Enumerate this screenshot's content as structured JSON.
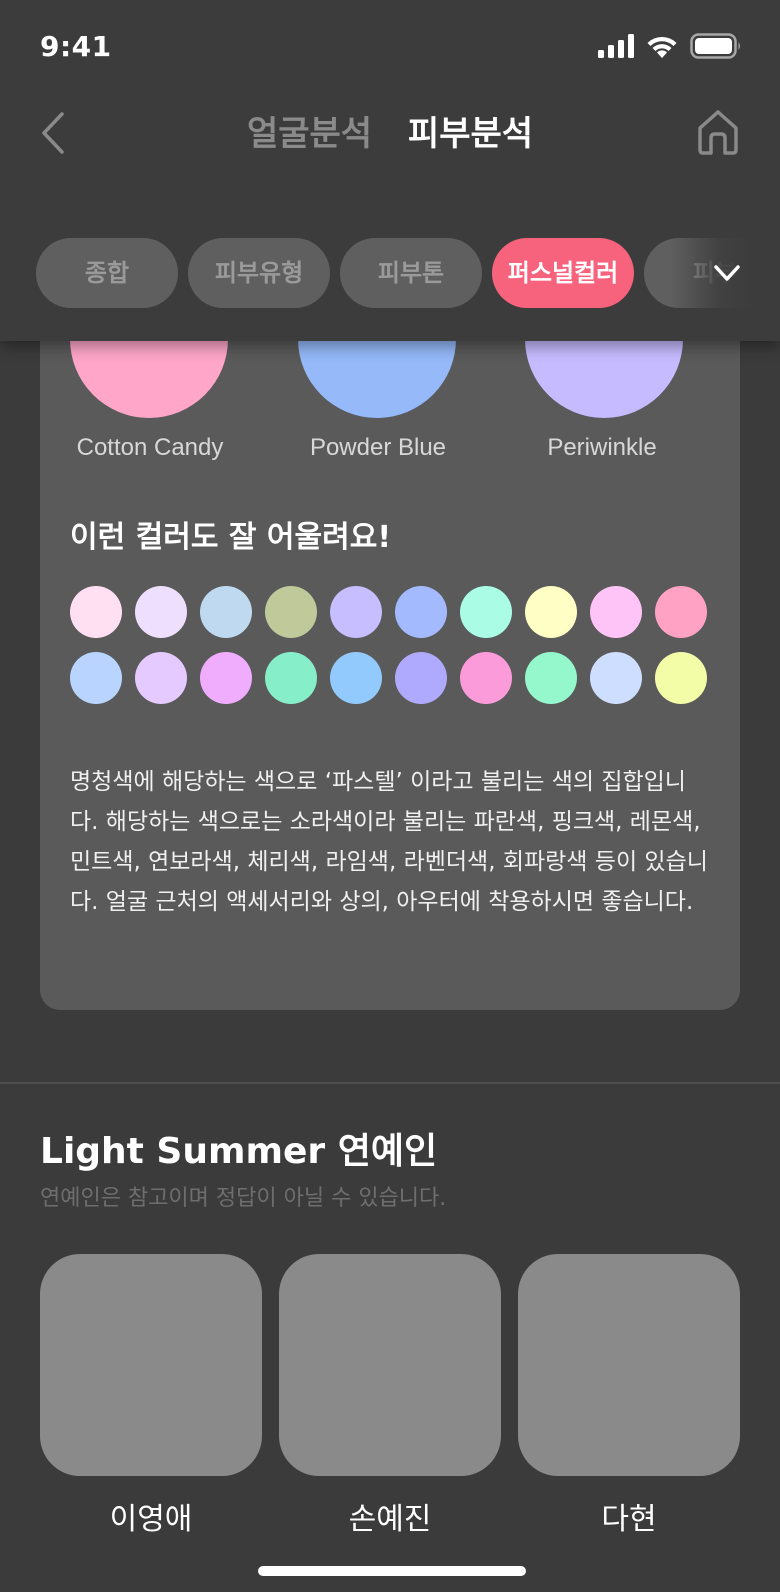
{
  "status_bar": {
    "time": "9:41"
  },
  "nav": {
    "tabs": [
      {
        "label": "얼굴분석",
        "active": false
      },
      {
        "label": "피부분석",
        "active": true
      }
    ]
  },
  "chips": [
    {
      "label": "종합",
      "active": false
    },
    {
      "label": "피부유형",
      "active": false
    },
    {
      "label": "피부톤",
      "active": false
    },
    {
      "label": "퍼스널컬러",
      "active": true
    },
    {
      "label": "피부",
      "active": false
    }
  ],
  "card": {
    "swatches": [
      {
        "name": "Cotton Candy",
        "color": "#ffa6c9"
      },
      {
        "name": "Powder Blue",
        "color": "#95b9f9"
      },
      {
        "name": "Periwinkle",
        "color": "#c6bbff"
      }
    ],
    "subtitle": "이런 컬러도 잘 어울려요!",
    "dot_rows": [
      [
        "#fee0f2",
        "#eedfff",
        "#bfd9f0",
        "#bfc99a",
        "#c6beff",
        "#a3baff",
        "#abfce5",
        "#fefec5",
        "#ffc4f7",
        "#ffa2c3"
      ],
      [
        "#b9d5ff",
        "#e4caff",
        "#f0adfe",
        "#86eec9",
        "#93cafe",
        "#b0aafe",
        "#fc9bd9",
        "#94f8cc",
        "#cedeff",
        "#f3fda7"
      ]
    ],
    "description": "명청색에 해당하는 색으로 ‘파스텔’ 이라고 불리는 색의 집합입니다. 해당하는 색으로는 소라색이라 불리는 파란색, 핑크색, 레몬색, 민트색, 연보라색, 체리색, 라임색, 라벤더색, 회파랑색 등이 있습니다. 얼굴 근처의 액세서리와 상의, 아우터에 착용하시면 좋습니다."
  },
  "celebs": {
    "title": "Light Summer 연예인",
    "subtitle": "연예인은 참고이며 정답이 아닐 수 있습니다.",
    "items": [
      {
        "name": "이영애"
      },
      {
        "name": "손예진"
      },
      {
        "name": "다현"
      }
    ]
  },
  "colors": {
    "accent": "#f7637c",
    "background": "#3b3b3b",
    "card": "#5a5a5a",
    "photo_placeholder": "#8b8a8b"
  },
  "icons": [
    "signal-icon",
    "wifi-icon",
    "battery-icon",
    "back-icon",
    "home-icon",
    "chevron-down-icon"
  ]
}
